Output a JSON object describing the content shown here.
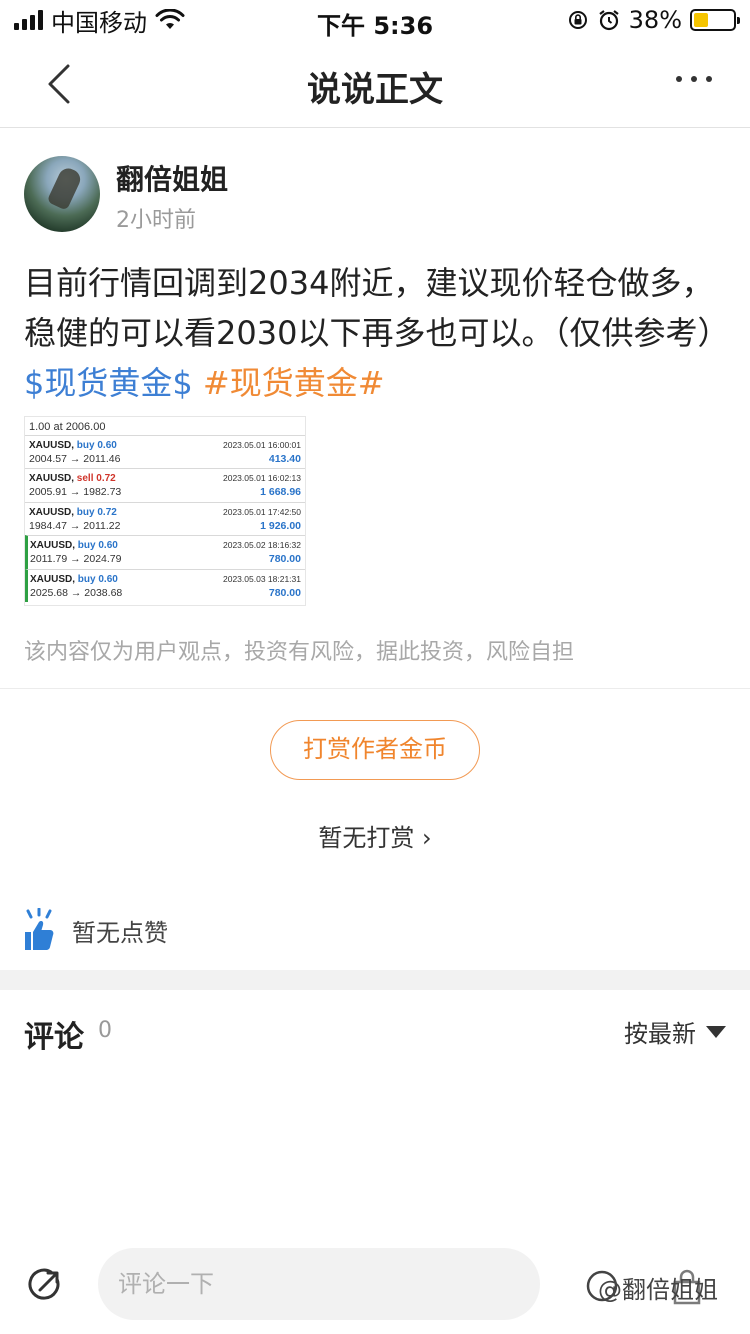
{
  "status_bar": {
    "carrier": "中国移动",
    "time": "下午 5:36",
    "battery_pct": "38%",
    "battery_level": 0.38
  },
  "nav": {
    "title": "说说正文"
  },
  "author": {
    "name": "翻倍姐姐",
    "time": "2小时前"
  },
  "post": {
    "text": "目前行情回调到2034附近，建议现价轻仓做多，稳健的可以看2030以下再多也可以。（仅供参考）",
    "tag_stock": "$现货黄金$",
    "tag_topic": "#现货黄金#"
  },
  "trade_image": {
    "header": "1.00 at 2006.00",
    "rows": [
      {
        "symbol": "XAUUSD,",
        "side": "buy 0.60",
        "side_type": "buy",
        "date": "2023.05.01 16:00:01",
        "prices": "2004.57 → 2011.46",
        "profit": "413.40",
        "green": false
      },
      {
        "symbol": "XAUUSD,",
        "side": "sell 0.72",
        "side_type": "sell",
        "date": "2023.05.01 16:02:13",
        "prices": "2005.91 → 1982.73",
        "profit": "1 668.96",
        "green": false
      },
      {
        "symbol": "XAUUSD,",
        "side": "buy 0.72",
        "side_type": "buy",
        "date": "2023.05.01 17:42:50",
        "prices": "1984.47 → 2011.22",
        "profit": "1 926.00",
        "green": false
      },
      {
        "symbol": "XAUUSD,",
        "side": "buy 0.60",
        "side_type": "buy",
        "date": "2023.05.02 18:16:32",
        "prices": "2011.79 → 2024.79",
        "profit": "780.00",
        "green": true
      },
      {
        "symbol": "XAUUSD,",
        "side": "buy 0.60",
        "side_type": "buy",
        "date": "2023.05.03 18:21:31",
        "prices": "2025.68 → 2038.68",
        "profit": "780.00",
        "green": true
      }
    ]
  },
  "disclaimer": "该内容仅为用户观点，投资有风险，据此投资，风险自担",
  "reward": {
    "button_label": "打赏作者金币",
    "status": "暂无打赏 ›"
  },
  "likes": {
    "text": "暂无点赞"
  },
  "comments": {
    "title": "评论",
    "count": "0",
    "sort_label": "按最新"
  },
  "bottom_bar": {
    "input_placeholder": "评论一下",
    "watermark": "@翻倍姐姐"
  },
  "colors": {
    "accent_orange": "#f0852d",
    "tag_blue": "#3d7fd4",
    "like_blue": "#2f7fd6"
  }
}
